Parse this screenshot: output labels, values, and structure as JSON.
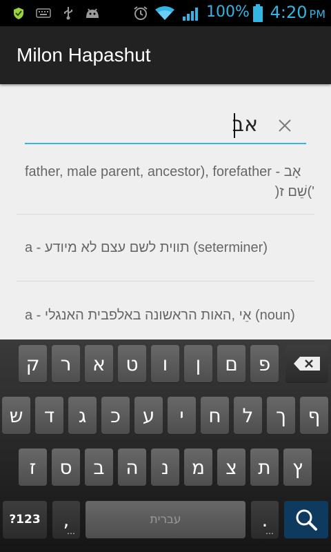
{
  "status_bar": {
    "battery_percent": "100%",
    "time": "4:20",
    "ampm": "PM"
  },
  "app_bar": {
    "title": "Milon Hapashut"
  },
  "search": {
    "value": "אב"
  },
  "results": [
    {
      "line1": "father, male parent, ancestor), forefather - אָב",
      "line2": ")שֵׁם ז('"
    },
    {
      "line1": "a - תווית לשם עצם לא מיודע (seterminer)"
    },
    {
      "line1": "a - אֵי ,האות הראשונה באלפבית האנגלי (noun)"
    }
  ],
  "keyboard": {
    "row1": [
      "ק",
      "ר",
      "א",
      "ט",
      "ו",
      "ן",
      "ם",
      "פ"
    ],
    "row2": [
      "ש",
      "ד",
      "ג",
      "כ",
      "ע",
      "י",
      "ח",
      "ל",
      "ך",
      "ף"
    ],
    "row3": [
      "ז",
      "ס",
      "ב",
      "ה",
      "נ",
      "מ",
      "צ",
      "ת",
      "ץ"
    ],
    "symbols_label": "?123",
    "comma_label": ",",
    "space_label": "עברית",
    "period_label": "."
  }
}
